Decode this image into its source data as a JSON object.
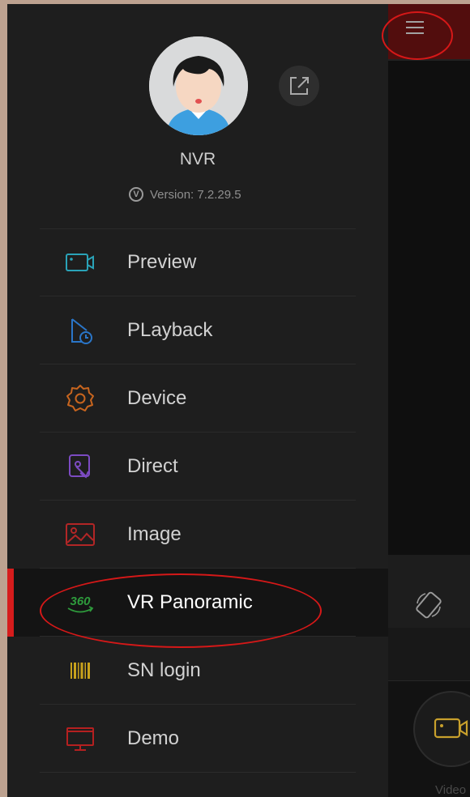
{
  "profile": {
    "name": "NVR",
    "version": "Version: 7.2.29.5"
  },
  "menu": {
    "items": [
      {
        "label": "Preview",
        "icon": "camera-icon",
        "color": "#2aa3b8"
      },
      {
        "label": "PLayback",
        "icon": "playback-file-clock-icon",
        "color": "#2a76c9"
      },
      {
        "label": "Device",
        "icon": "gear-icon",
        "color": "#c8651e"
      },
      {
        "label": "Direct",
        "icon": "direct-link-icon",
        "color": "#7c4bc2"
      },
      {
        "label": "Image",
        "icon": "image-icon",
        "color": "#b22626"
      },
      {
        "label": "VR Panoramic",
        "icon": "vr-360-icon",
        "color": "#2e9b3c",
        "active": true,
        "icon_text": "360"
      },
      {
        "label": "SN login",
        "icon": "barcode-icon",
        "color": "#c9a21c"
      },
      {
        "label": "Demo",
        "icon": "monitor-icon",
        "color": "#b52020"
      }
    ]
  },
  "right_panel": {
    "video_label": "Video"
  },
  "colors": {
    "accent_red": "#d61c1c",
    "drawer_bg": "#1e1e1e"
  }
}
